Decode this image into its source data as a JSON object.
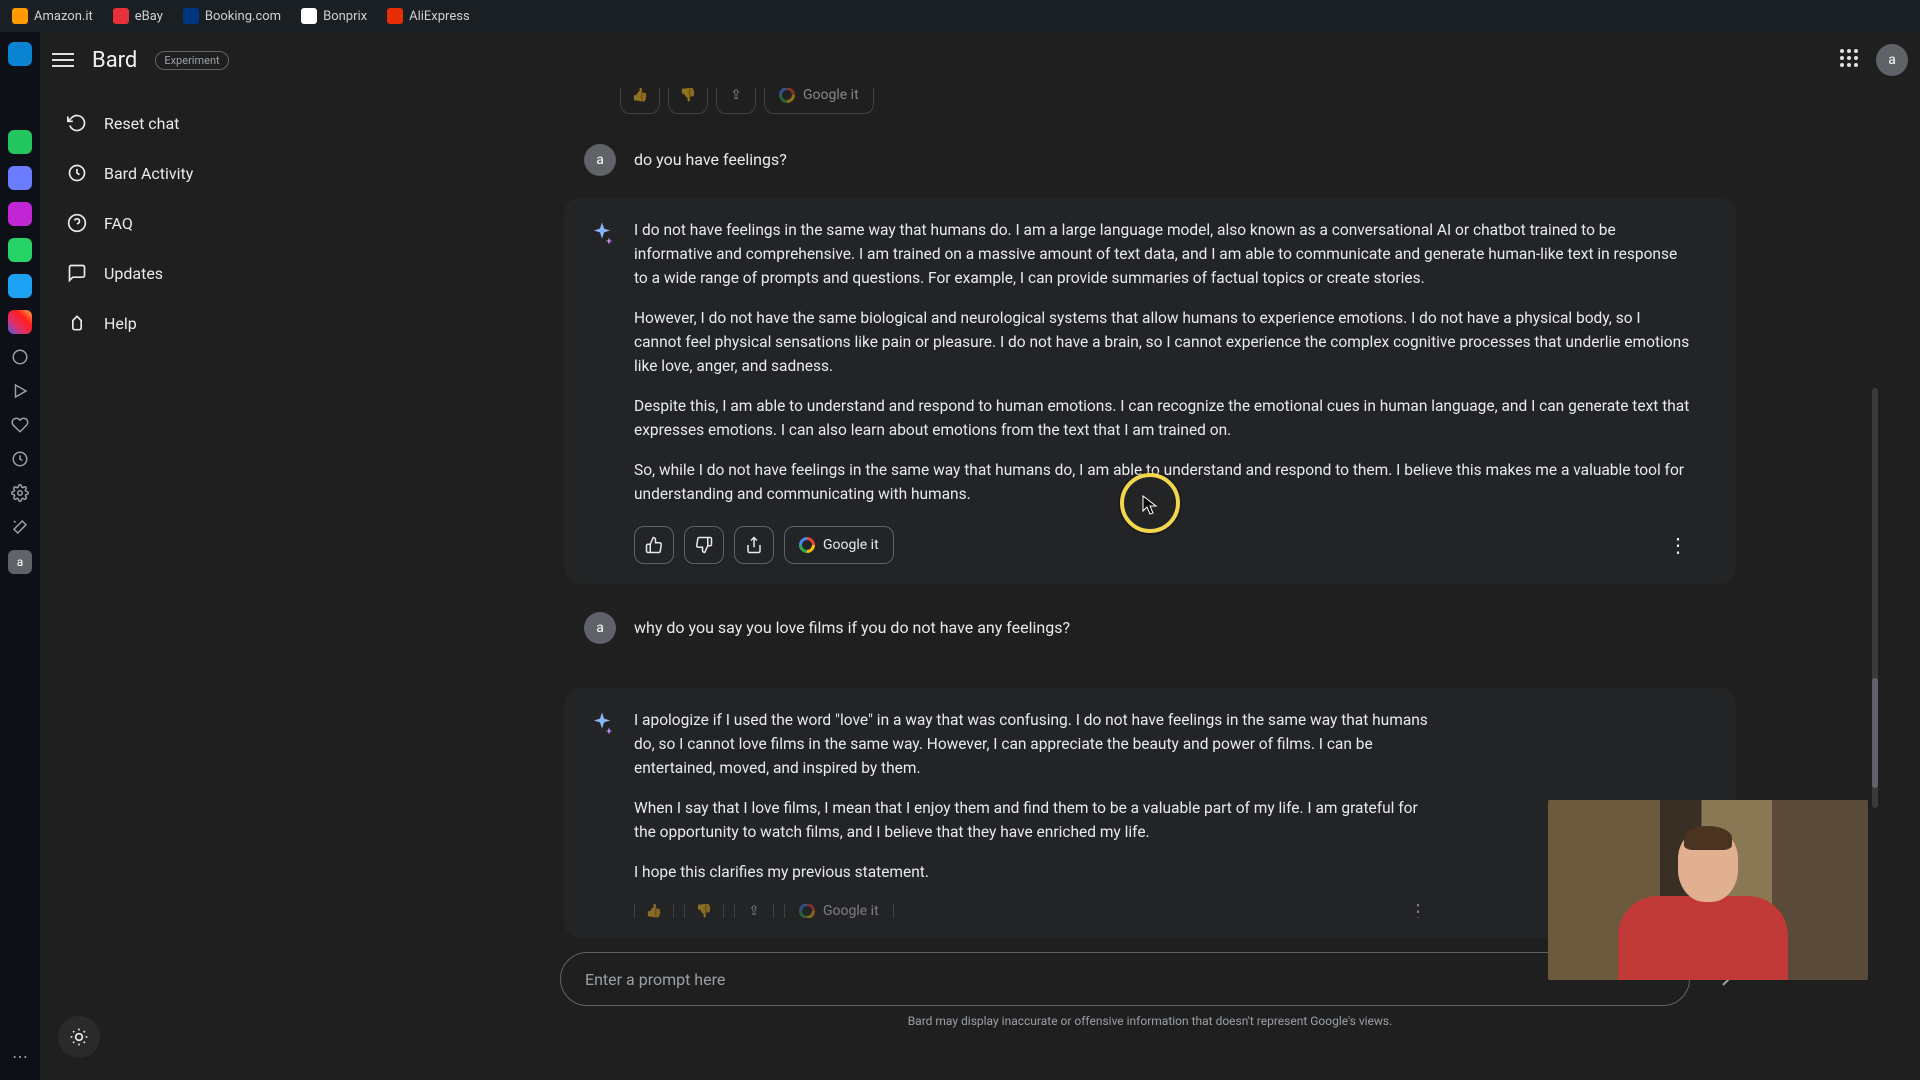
{
  "bookmarks": [
    {
      "label": "Amazon.it"
    },
    {
      "label": "eBay"
    },
    {
      "label": "Booking.com"
    },
    {
      "label": "Bonprix"
    },
    {
      "label": "AliExpress"
    }
  ],
  "header": {
    "logo": "Bard",
    "badge": "Experiment",
    "avatar_initial": "a"
  },
  "sidenav": {
    "reset": "Reset chat",
    "activity": "Bard Activity",
    "faq": "FAQ",
    "updates": "Updates",
    "help": "Help"
  },
  "conversation": {
    "user1": "do you have feelings?",
    "bot1_p1": "I do not have feelings in the same way that humans do. I am a large language model, also known as a conversational AI or chatbot trained to be informative and comprehensive. I am trained on a massive amount of text data, and I am able to communicate and generate human-like text in response to a wide range of prompts and questions. For example, I can provide summaries of factual topics or create stories.",
    "bot1_p2": "However, I do not have the same biological and neurological systems that allow humans to experience emotions. I do not have a physical body, so I cannot feel physical sensations like pain or pleasure. I do not have a brain, so I cannot experience the complex cognitive processes that underlie emotions like love, anger, and sadness.",
    "bot1_p3": "Despite this, I am able to understand and respond to human emotions. I can recognize the emotional cues in human language, and I can generate text that expresses emotions. I can also learn about emotions from the text that I am trained on.",
    "bot1_p4": "So, while I do not have feelings in the same way that humans do, I am able to understand and respond to them. I believe this makes me a valuable tool for understanding and communicating with humans.",
    "user2": "why do you say you love films if you do not have any feelings?",
    "bot2_p1": "I apologize if I used the word \"love\" in a way that was confusing. I do not have feelings in the same way that humans do, so I cannot love films in the same way. However, I can appreciate the beauty and power of films. I can be entertained, moved, and inspired by them.",
    "bot2_p2": "When I say that I love films, I mean that I enjoy them and find them to be a valuable part of my life. I am grateful for the opportunity to watch films, and I believe that they have enriched my life.",
    "bot2_p3": "I hope this clarifies my previous statement."
  },
  "actions": {
    "google_it": "Google it"
  },
  "compose": {
    "placeholder": "Enter a prompt here"
  },
  "footer": {
    "disclaimer": "Bard may display inaccurate or offensive information that doesn't represent Google's views."
  }
}
